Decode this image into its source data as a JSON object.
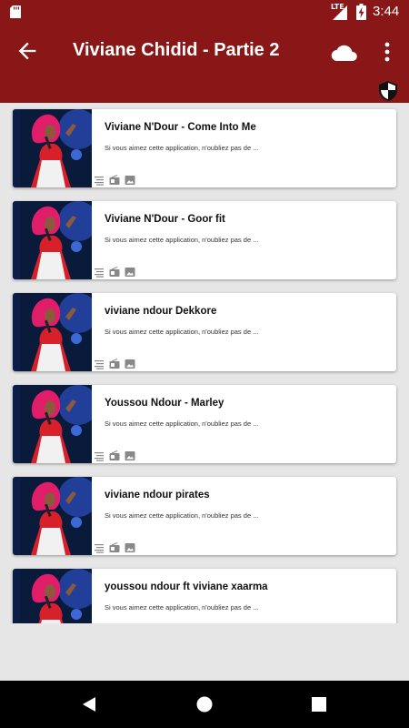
{
  "status_bar": {
    "network": "LTE",
    "time": "3:44",
    "icons": [
      "sd-card-icon",
      "lte-signal-icon",
      "battery-charging-icon"
    ]
  },
  "app_bar": {
    "title": "Viviane Chidid - Partie 2",
    "icons": [
      "back-arrow-icon",
      "cloud-icon",
      "more-vert-icon",
      "shield-icon"
    ]
  },
  "colors": {
    "app_bar": "#8a1717",
    "background": "#e6e6e6",
    "card": "#ffffff",
    "nav_bar": "#000000"
  },
  "songs": [
    {
      "title": "Viviane N'Dour - Come Into Me",
      "description": "Si vous aimez cette application, n'oubliez pas de ..."
    },
    {
      "title": "Viviane N'Dour - Goor fit",
      "description": "Si vous aimez cette application, n'oubliez pas de ..."
    },
    {
      "title": "viviane ndour Dekkore",
      "description": "Si vous aimez cette application, n'oubliez pas de ..."
    },
    {
      "title": "Youssou Ndour - Marley",
      "description": "Si vous aimez cette application, n'oubliez pas de ..."
    },
    {
      "title": "viviane ndour pirates",
      "description": "Si vous aimez cette application, n'oubliez pas de ..."
    },
    {
      "title": "youssou ndour ft viviane xaarma",
      "description": "Si vous aimez cette application, n'oubliez pas de ..."
    }
  ],
  "card_icons": [
    "lyrics-icon",
    "radio-icon",
    "image-icon"
  ],
  "nav_bar": {
    "icons": [
      "nav-back-icon",
      "nav-home-icon",
      "nav-recents-icon"
    ]
  }
}
